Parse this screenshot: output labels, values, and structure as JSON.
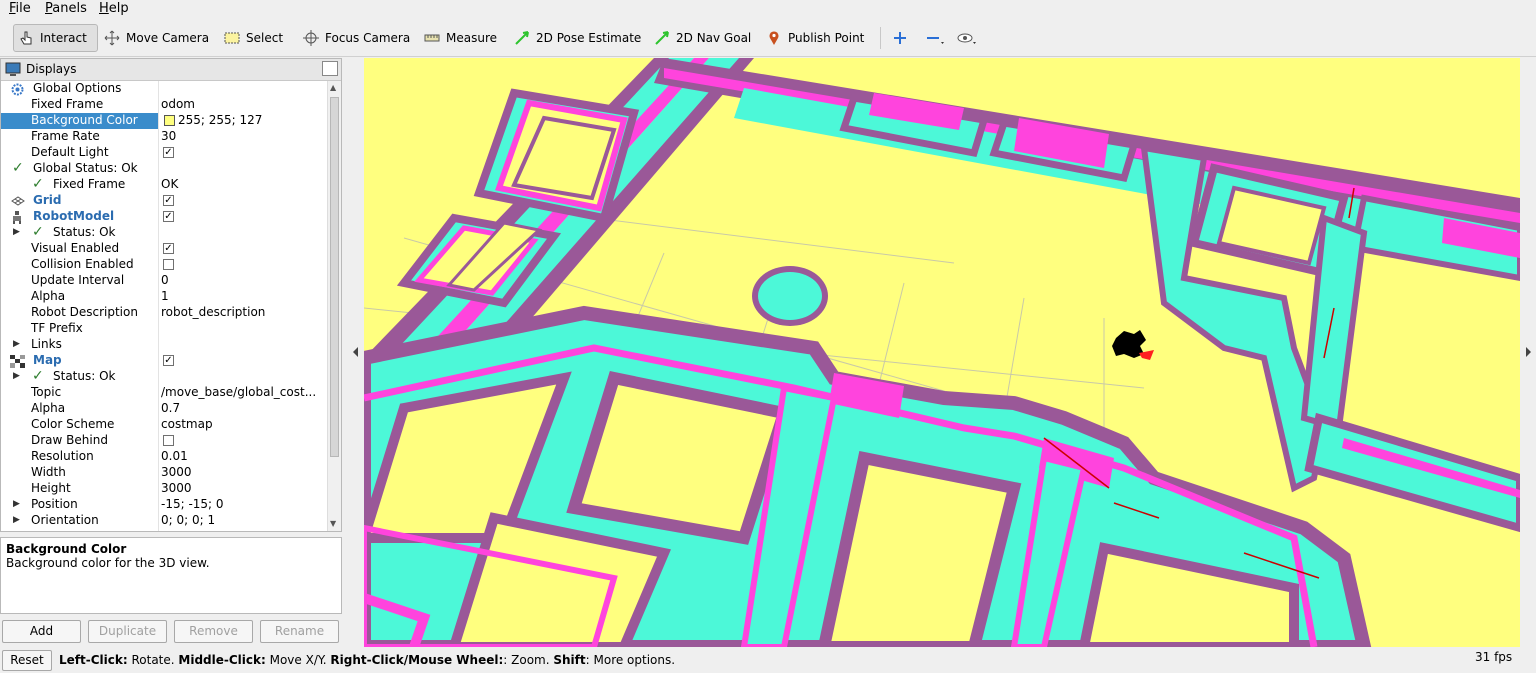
{
  "menu": {
    "file": "File",
    "panels": "Panels",
    "help": "Help"
  },
  "toolbar": {
    "interact": "Interact",
    "move_camera": "Move Camera",
    "select": "Select",
    "focus_camera": "Focus Camera",
    "measure": "Measure",
    "pose_estimate": "2D Pose Estimate",
    "nav_goal": "2D Nav Goal",
    "publish_point": "Publish Point"
  },
  "displays": {
    "title": "Displays",
    "rows": [
      {
        "name": "Global Options",
        "value": ""
      },
      {
        "name": "Fixed Frame",
        "value": "odom"
      },
      {
        "name": "Background Color",
        "value": "255; 255; 127"
      },
      {
        "name": "Frame Rate",
        "value": "30"
      },
      {
        "name": "Default Light",
        "value": ""
      },
      {
        "name": "Global Status: Ok",
        "value": ""
      },
      {
        "name": "Fixed Frame",
        "value": "OK"
      },
      {
        "name": "Grid",
        "value": ""
      },
      {
        "name": "RobotModel",
        "value": ""
      },
      {
        "name": "Status: Ok",
        "value": ""
      },
      {
        "name": "Visual Enabled",
        "value": ""
      },
      {
        "name": "Collision Enabled",
        "value": ""
      },
      {
        "name": "Update Interval",
        "value": "0"
      },
      {
        "name": "Alpha",
        "value": "1"
      },
      {
        "name": "Robot Description",
        "value": "robot_description"
      },
      {
        "name": "TF Prefix",
        "value": ""
      },
      {
        "name": "Links",
        "value": ""
      },
      {
        "name": "Map",
        "value": ""
      },
      {
        "name": "Status: Ok",
        "value": ""
      },
      {
        "name": "Topic",
        "value": "/move_base/global_cost..."
      },
      {
        "name": "Alpha",
        "value": "0.7"
      },
      {
        "name": "Color Scheme",
        "value": "costmap"
      },
      {
        "name": "Draw Behind",
        "value": ""
      },
      {
        "name": "Resolution",
        "value": "0.01"
      },
      {
        "name": "Width",
        "value": "3000"
      },
      {
        "name": "Height",
        "value": "3000"
      },
      {
        "name": "Position",
        "value": "-15; -15; 0"
      },
      {
        "name": "Orientation",
        "value": "0; 0; 0; 1"
      }
    ]
  },
  "description": {
    "title": "Background Color",
    "text": "Background color for the 3D view."
  },
  "buttons": {
    "add": "Add",
    "duplicate": "Duplicate",
    "remove": "Remove",
    "rename": "Rename"
  },
  "status": {
    "reset": "Reset",
    "left_click_key": "Left-Click:",
    "left_click_val": " Rotate. ",
    "middle_click_key": "Middle-Click:",
    "middle_click_val": " Move X/Y. ",
    "right_click_key": "Right-Click/Mouse Wheel:",
    "right_click_val": ": Zoom. ",
    "shift_key": "Shift",
    "shift_val": ": More options.",
    "fps": "31 fps"
  },
  "colors": {
    "background": "#ffff7f",
    "costmap_lethal": "#ff44dd",
    "costmap_inflated": "#4cf8d8",
    "costmap_edge": "#9a5898",
    "selection": "#3a8ccb"
  }
}
